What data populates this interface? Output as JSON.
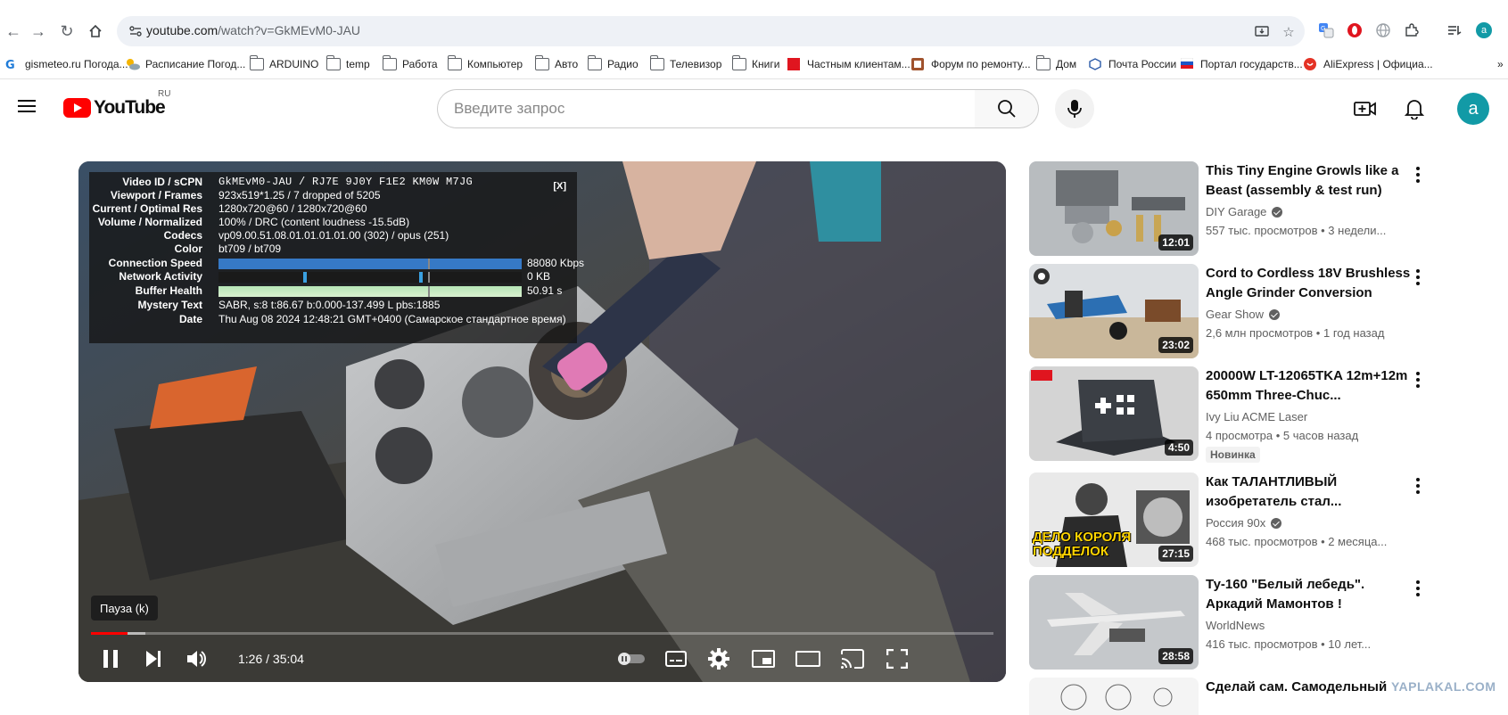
{
  "browser": {
    "url_host": "youtube.com",
    "url_path": "/watch?v=GkMEvM0-JAU",
    "bookmarks": [
      {
        "label": "gismeteo.ru Погода...",
        "icon": "gismeteo-icon"
      },
      {
        "label": "Расписание Погод...",
        "icon": "weather-icon"
      },
      {
        "label": "ARDUINO",
        "icon": "folder-icon"
      },
      {
        "label": "temp",
        "icon": "folder-icon"
      },
      {
        "label": "Работа",
        "icon": "folder-icon"
      },
      {
        "label": "Компьютер",
        "icon": "folder-icon"
      },
      {
        "label": "Авто",
        "icon": "folder-icon"
      },
      {
        "label": "Радио",
        "icon": "folder-icon"
      },
      {
        "label": "Телевизор",
        "icon": "folder-icon"
      },
      {
        "label": "Книги",
        "icon": "folder-icon"
      },
      {
        "label": "Частным клиентам...",
        "icon": "bank-icon"
      },
      {
        "label": "Форум по ремонту...",
        "icon": "forum-icon"
      },
      {
        "label": "Дом",
        "icon": "folder-icon"
      },
      {
        "label": "Почта России",
        "icon": "post-icon"
      },
      {
        "label": "Портал государств...",
        "icon": "gov-icon"
      },
      {
        "label": "AliExpress | Официа...",
        "icon": "aliexpress-icon"
      }
    ],
    "overflow": "»"
  },
  "masthead": {
    "logo_text": "YouTube",
    "region": "RU",
    "search_placeholder": "Введите запрос",
    "avatar_letter": "a"
  },
  "player": {
    "stats": {
      "close": "[X]",
      "video_id_label": "Video ID / sCPN",
      "video_id_value": "GkMEvM0-JAU / RJ7E 9J0Y F1E2 KM0W M7JG",
      "viewport_label": "Viewport / Frames",
      "viewport_value": "923x519*1.25 / 7 dropped of 5205",
      "res_label": "Current / Optimal Res",
      "res_value": "1280x720@60 / 1280x720@60",
      "volume_label": "Volume / Normalized",
      "volume_value": "100% / DRC (content loudness -15.5dB)",
      "codecs_label": "Codecs",
      "codecs_value": "vp09.00.51.08.01.01.01.01.00 (302) / opus (251)",
      "color_label": "Color",
      "color_value": "bt709 / bt709",
      "speed_label": "Connection Speed",
      "speed_value": "88080 Kbps",
      "network_label": "Network Activity",
      "network_value": "0 KB",
      "buffer_label": "Buffer Health",
      "buffer_value": "50.91 s",
      "mystery_label": "Mystery Text",
      "mystery_value": "SABR, s:8 t:86.67 b:0.000-137.499 L pbs:1885",
      "date_label": "Date",
      "date_value": "Thu Aug 08 2024 12:48:21 GMT+0400 (Самарское стандартное время)"
    },
    "tooltip": "Пауза (k)",
    "time": "1:26 / 35:04",
    "played_fraction": 0.041,
    "loaded_fraction": 0.06
  },
  "recommendations": [
    {
      "title": "This Tiny Engine Growls like a Beast (assembly & test run)",
      "channel": "DIY Garage",
      "verified": true,
      "meta": "557 тыс. просмотров • 3 недели...",
      "duration": "12:01",
      "badge": ""
    },
    {
      "title": "Cord to Cordless 18V Brushless Angle Grinder Conversion",
      "channel": "Gear Show",
      "verified": true,
      "meta": "2,6 млн просмотров • 1 год назад",
      "duration": "23:02",
      "badge": ""
    },
    {
      "title": "20000W LT-12065TKA 12m+12m 650mm Three-Chuc...",
      "channel": "Ivy Liu ACME Laser",
      "verified": false,
      "meta": "4 просмотра • 5 часов назад",
      "duration": "4:50",
      "badge": "Новинка"
    },
    {
      "title": "Как ТАЛАНТЛИВЫЙ изобретатель стал...",
      "channel": "Россия 90х",
      "verified": true,
      "meta": "468 тыс. просмотров • 2 месяца...",
      "duration": "27:15",
      "badge": "",
      "thumb_text": "ДЕЛО КОРОЛЯ ПОДДЕЛОК"
    },
    {
      "title": "Ту-160 \"Белый лебедь\". Аркадий Мамонтов !",
      "channel": "WorldNews",
      "verified": false,
      "meta": "416 тыс. просмотров • 10 лет...",
      "duration": "28:58",
      "badge": ""
    },
    {
      "title": "Сделай сам. Самодельный",
      "channel": "",
      "verified": false,
      "meta": "",
      "duration": "",
      "badge": ""
    }
  ],
  "watermark": "YAPLAKAL.COM"
}
